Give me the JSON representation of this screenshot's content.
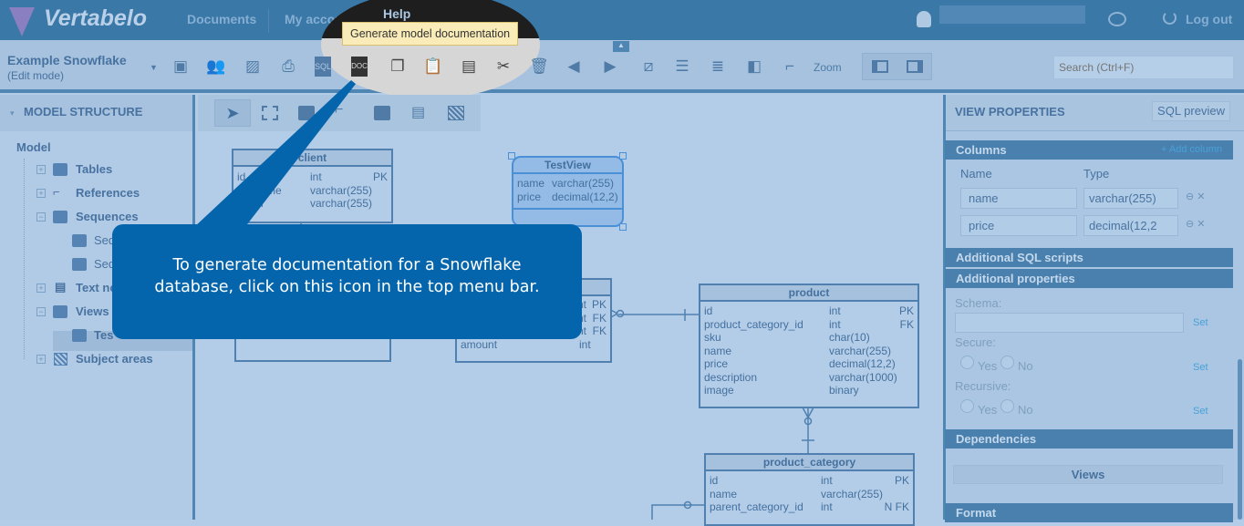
{
  "header": {
    "logo": "Vertabelo",
    "nav": [
      "Documents",
      "My account",
      "Help"
    ],
    "logout": "Log out"
  },
  "tooltip": "Generate model documentation",
  "model": {
    "name": "Example Snowflake",
    "mode": "(Edit mode)"
  },
  "toolbar": {
    "zoom": "Zoom",
    "search_placeholder": "Search (Ctrl+F)"
  },
  "sidebar": {
    "title": "MODEL STRUCTURE",
    "root": "Model",
    "items": [
      "Tables",
      "References",
      "Sequences",
      "Seq",
      "Seq",
      "Text no",
      "Views",
      "Tes",
      "Subject areas"
    ]
  },
  "callout": {
    "line1": "To generate documentation for a Snowflake",
    "line2": "database, click on this icon in the top menu bar."
  },
  "tables": {
    "client": {
      "name": "client",
      "rows": [
        [
          "id",
          "int",
          "PK"
        ],
        [
          "ail_name",
          "varchar(255)",
          ""
        ],
        [
          "email",
          "varchar(255)",
          ""
        ]
      ]
    },
    "testview": {
      "name": "TestView",
      "rows": [
        [
          "name",
          "varchar(255)"
        ],
        [
          "price",
          "decimal(12,2)"
        ]
      ]
    },
    "orders": {
      "rows": [
        [
          "",
          "nt",
          "PK"
        ],
        [
          "",
          "nt",
          "FK"
        ],
        [
          "",
          "nt",
          "FK"
        ],
        [
          "amount",
          "int",
          ""
        ]
      ]
    },
    "product": {
      "name": "product",
      "rows": [
        [
          "id",
          "int",
          "PK"
        ],
        [
          "product_category_id",
          "int",
          "FK"
        ],
        [
          "sku",
          "char(10)",
          ""
        ],
        [
          "name",
          "varchar(255)",
          ""
        ],
        [
          "price",
          "decimal(12,2)",
          ""
        ],
        [
          "description",
          "varchar(1000)",
          ""
        ],
        [
          "image",
          "binary",
          ""
        ]
      ]
    },
    "product_category": {
      "name": "product_category",
      "rows": [
        [
          "id",
          "int",
          "PK"
        ],
        [
          "name",
          "varchar(255)",
          ""
        ],
        [
          "parent_category_id",
          "int",
          "N FK"
        ]
      ]
    }
  },
  "props": {
    "title": "VIEW PROPERTIES",
    "sql_preview": "SQL preview",
    "columns": "Columns",
    "add_column": "+ Add column",
    "col_name": "Name",
    "col_type": "Type",
    "cols": [
      {
        "name": "name",
        "type": "varchar(255)"
      },
      {
        "name": "price",
        "type": "decimal(12,2"
      }
    ],
    "additional_sql": "Additional SQL scripts",
    "additional_props": "Additional properties",
    "schema": "Schema:",
    "secure": "Secure:",
    "recursive": "Recursive:",
    "yes": "Yes",
    "no": "No",
    "set": "Set",
    "dependencies": "Dependencies",
    "views": "Views",
    "format": "Format"
  }
}
